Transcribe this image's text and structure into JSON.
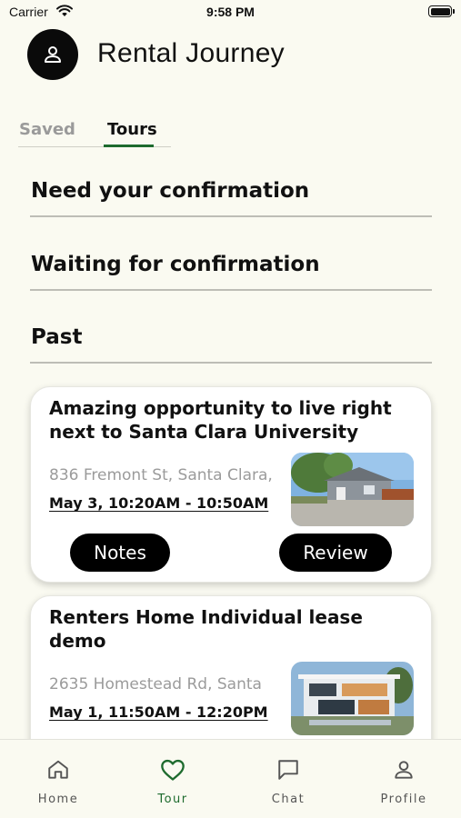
{
  "status_bar": {
    "carrier": "Carrier",
    "time": "9:58 PM"
  },
  "header": {
    "title": "Rental Journey",
    "avatar_icon": "person-icon"
  },
  "tabs": [
    {
      "label": "Saved",
      "active": false
    },
    {
      "label": "Tours",
      "active": true
    }
  ],
  "sections": [
    {
      "label": "Need your confirmation"
    },
    {
      "label": "Waiting for confirmation"
    },
    {
      "label": "Past"
    }
  ],
  "tours": [
    {
      "title": "Amazing opportunity to live right next to Santa Clara University",
      "address": "836 Fremont St, Santa Clara,",
      "time": "May 3, 10:20AM - 10:50AM",
      "notes_label": "Notes",
      "review_label": "Review"
    },
    {
      "title": "Renters Home Individual lease demo",
      "address": "2635 Homestead Rd, Santa",
      "time": "May 1, 11:50AM - 12:20PM"
    }
  ],
  "bottom_nav": [
    {
      "label": "Home",
      "icon": "home-icon",
      "active": false
    },
    {
      "label": "Tour",
      "icon": "heart-icon",
      "active": true
    },
    {
      "label": "Chat",
      "icon": "chat-icon",
      "active": false
    },
    {
      "label": "Profile",
      "icon": "person-icon",
      "active": false
    }
  ],
  "colors": {
    "background": "#fafaf1",
    "accent": "#1e6b2e",
    "button": "#000000"
  }
}
